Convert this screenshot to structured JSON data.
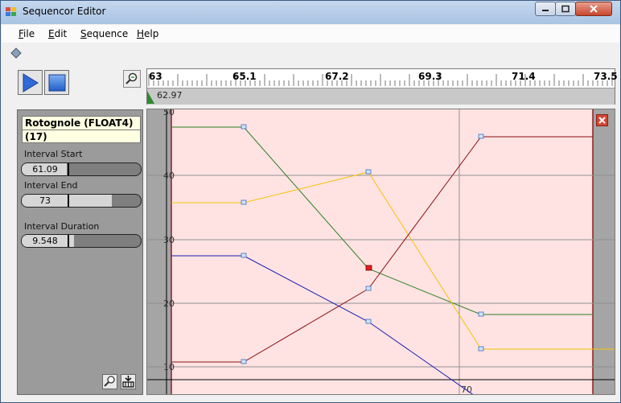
{
  "window": {
    "title": "Sequencor Editor"
  },
  "menu": [
    {
      "key": "F",
      "rest": "ile"
    },
    {
      "key": "E",
      "rest": "dit"
    },
    {
      "key": "S",
      "rest": "equence"
    },
    {
      "key": "H",
      "rest": "elp"
    }
  ],
  "ruler": {
    "labels": [
      "63",
      "65.1",
      "67.2",
      "69.3",
      "71.4",
      "73.5"
    ],
    "cursor_value": "62.97"
  },
  "panel": {
    "name_line1": "Rotognole (FLOAT4)",
    "name_line2": "(17)",
    "interval_start_label": "Interval Start",
    "interval_start_value": "61.09",
    "interval_start_fraction": 0.38,
    "interval_end_label": "Interval End",
    "interval_end_value": "73",
    "interval_end_fraction": 0.76,
    "interval_duration_label": "Interval Duration",
    "interval_duration_value": "9.548",
    "interval_duration_fraction": 0.44
  },
  "graph": {
    "y_ticks": [
      "50",
      "40",
      "30",
      "20",
      "10"
    ],
    "x_marker": "70",
    "colors": {
      "green": "#2e7d1f",
      "yellow": "#f5c400",
      "red": "#8b1010",
      "blue": "#1a1ab0",
      "band": "#ffe3e3",
      "band_border": "#8b2020"
    }
  }
}
